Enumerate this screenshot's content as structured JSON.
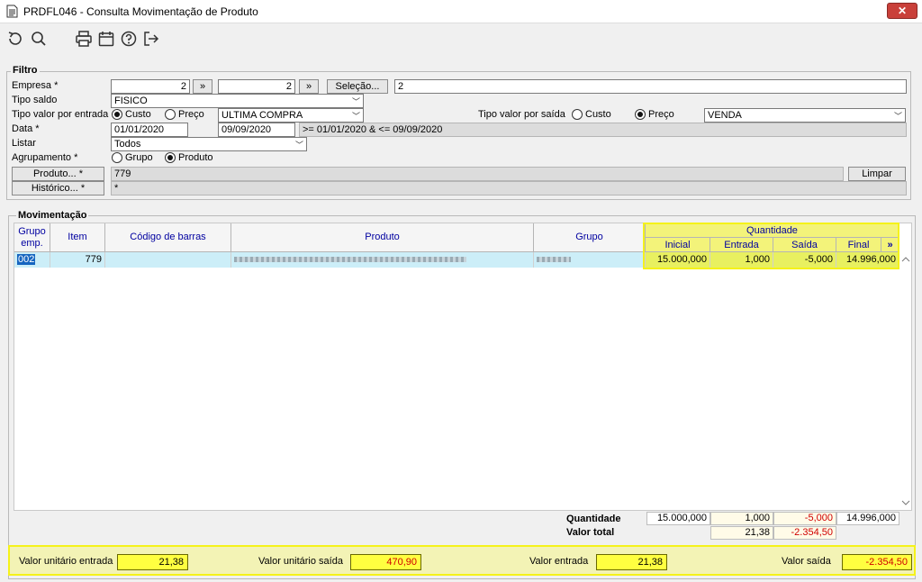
{
  "window": {
    "title": "PRDFL046 - Consulta Movimentação de Produto",
    "close_label": "✕"
  },
  "toolbar": [
    "refresh-icon",
    "search-icon",
    "print-icon",
    "calendar-icon",
    "help-icon",
    "exit-icon"
  ],
  "filtro": {
    "legend": "Filtro",
    "empresa_label": "Empresa *",
    "empresa_from": "2",
    "empresa_to": "2",
    "jump_label": "»",
    "selecao_label": "Seleção...",
    "selecao_value": "2",
    "tipo_saldo_label": "Tipo saldo",
    "tipo_saldo_value": "FISICO",
    "tipo_entrada_label": "Tipo valor por entrada",
    "custo_label": "Custo",
    "preco_label": "Preço",
    "entrada_value": "ULTIMA COMPRA",
    "tipo_saida_label": "Tipo valor por saída",
    "saida_value": "VENDA",
    "data_label": "Data *",
    "data_from": "01/01/2020",
    "data_to": "09/09/2020",
    "data_expr": ">= 01/01/2020 & <= 09/09/2020",
    "listar_label": "Listar",
    "listar_value": "Todos",
    "agrupamento_label": "Agrupamento *",
    "grupo_label": "Grupo",
    "produto_label": "Produto",
    "produto_btn": "Produto... *",
    "produto_value": "779",
    "limpar_label": "Limpar",
    "historico_btn": "Histórico... *",
    "historico_value": "*"
  },
  "movimentacao": {
    "legend": "Movimentação",
    "columns": {
      "grupo_emp": "Grupo emp.",
      "item": "Item",
      "codigo_barras": "Código de barras",
      "produto": "Produto",
      "grupo": "Grupo",
      "quantidade": "Quantidade",
      "inicial": "Inicial",
      "entrada": "Entrada",
      "saida": "Saída",
      "final": "Final",
      "more": "»"
    },
    "rows": [
      {
        "grupo_emp": "002",
        "item": "779",
        "codigo_barras": "",
        "inicial": "15.000,000",
        "entrada": "1,000",
        "saida": "-5,000",
        "final": "14.996,000"
      }
    ],
    "totals": {
      "quantidade_label": "Quantidade",
      "inicial": "15.000,000",
      "entrada": "1,000",
      "saida": "-5,000",
      "final": "14.996,000",
      "valor_total_label": "Valor total",
      "vt_entrada": "21,38",
      "vt_saida": "-2.354,50"
    }
  },
  "footer": {
    "vu_entrada_label": "Valor unitário entrada",
    "vu_entrada": "21,38",
    "vu_saida_label": "Valor unitário saída",
    "vu_saida": "470,90",
    "v_entrada_label": "Valor entrada",
    "v_entrada": "21,38",
    "v_saida_label": "Valor saída",
    "v_saida": "-2.354,50"
  }
}
